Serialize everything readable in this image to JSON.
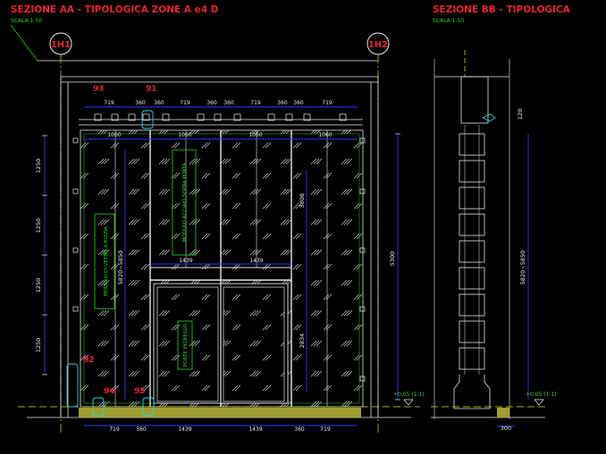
{
  "titles": {
    "section_aa": "SEZIONE AA - TIPOLOGICA ZONE A e4 D",
    "section_aa_scale": "SCALA 1:50",
    "section_bb": "SEZIONE BB - TIPOLOGICA",
    "section_bb_scale": "SCALA 1:50"
  },
  "grid_axes": {
    "axis_1": "1H1",
    "axis_2": "1H2"
  },
  "node_labels": {
    "n93": "93",
    "n91": "91",
    "n92": "92",
    "n94": "94",
    "n95": "95"
  },
  "top_dims": [
    "719",
    "360",
    "360",
    "719",
    "360",
    "360",
    "719",
    "360",
    "360",
    "719"
  ],
  "panel_dims": [
    "1060",
    "1060",
    "1060",
    "1060"
  ],
  "bottom_dims": [
    "719",
    "360",
    "1439",
    "1439",
    "360",
    "719"
  ],
  "mid_dims": [
    "1439",
    "1439"
  ],
  "left_dims": [
    "1250",
    "1250",
    "1250",
    "1250"
  ],
  "inner_dims": {
    "a": "5820~5850",
    "b": "3808",
    "c": "2834",
    "total": "5300",
    "bb_top": "120",
    "bb_height": "5820~5850",
    "bb_width": "300"
  },
  "levels": {
    "aa": "+0.05 (1:1)",
    "bb": "+0.05 (1:1)"
  },
  "tags": {
    "left_module": "MODULO DI VETRO A RIZZIA",
    "center_module": "MODULO ACCIAIO SOPRA PORTA",
    "door": "PORTE INGRESSO"
  },
  "colors": {
    "background": "#000000",
    "red_text": "#e8232a",
    "green_text": "#22dd22",
    "white_line": "#e8e8e8",
    "blue_dim": "#3333ff",
    "yellow_axis": "#e6e600",
    "cyan_node": "#22dddd",
    "ground_fill": "#b8b83a"
  }
}
